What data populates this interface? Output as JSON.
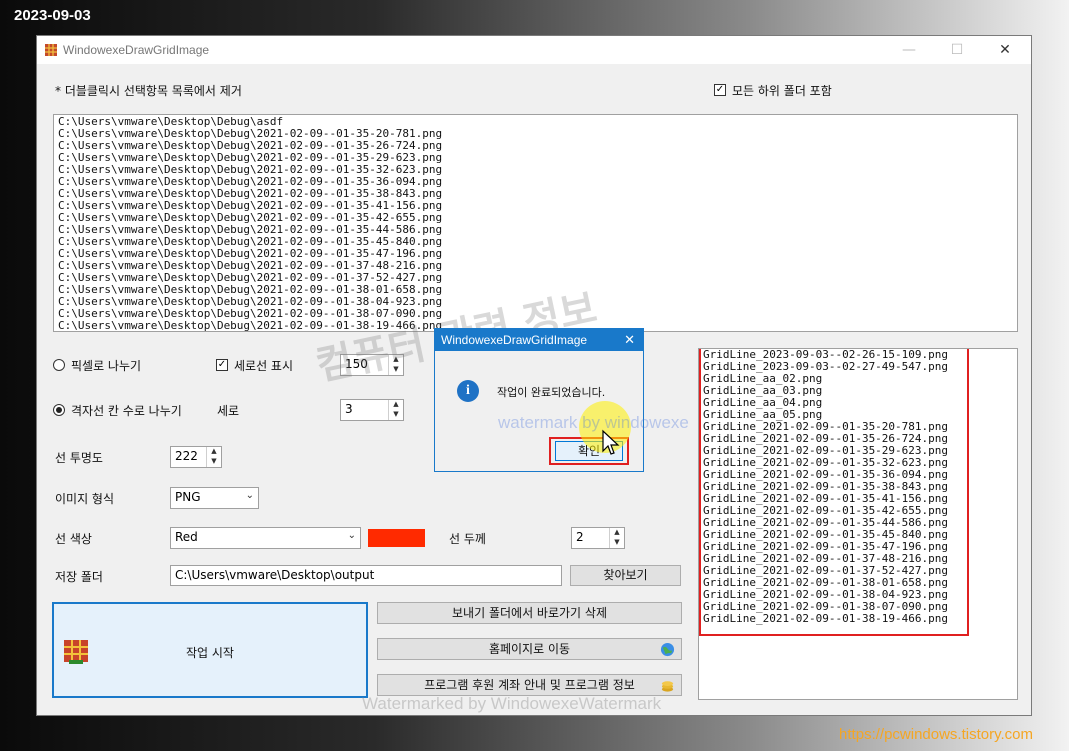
{
  "overlay": {
    "date": "2023-09-03",
    "site_url": "https://pcwindows.tistory.com",
    "watermark_korean": "컴퓨터 관련 정보",
    "watermark_dialog": "watermark by windowexe",
    "watermark_bottom": "Watermarked by WindowexeWatermark"
  },
  "window": {
    "title": "WindowexeDrawGridImage",
    "minimize": "—",
    "maximize": "☐",
    "close": "✕"
  },
  "main": {
    "hint_label": "* 더블클릭시 선택항목 목록에서 제거",
    "include_subfolders_label": "모든 하위 폴더 포함",
    "include_subfolders_checked": true,
    "file_list": [
      "C:\\Users\\vmware\\Desktop\\Debug\\asdf",
      "C:\\Users\\vmware\\Desktop\\Debug\\2021-02-09--01-35-20-781.png",
      "C:\\Users\\vmware\\Desktop\\Debug\\2021-02-09--01-35-26-724.png",
      "C:\\Users\\vmware\\Desktop\\Debug\\2021-02-09--01-35-29-623.png",
      "C:\\Users\\vmware\\Desktop\\Debug\\2021-02-09--01-35-32-623.png",
      "C:\\Users\\vmware\\Desktop\\Debug\\2021-02-09--01-35-36-094.png",
      "C:\\Users\\vmware\\Desktop\\Debug\\2021-02-09--01-35-38-843.png",
      "C:\\Users\\vmware\\Desktop\\Debug\\2021-02-09--01-35-41-156.png",
      "C:\\Users\\vmware\\Desktop\\Debug\\2021-02-09--01-35-42-655.png",
      "C:\\Users\\vmware\\Desktop\\Debug\\2021-02-09--01-35-44-586.png",
      "C:\\Users\\vmware\\Desktop\\Debug\\2021-02-09--01-35-45-840.png",
      "C:\\Users\\vmware\\Desktop\\Debug\\2021-02-09--01-35-47-196.png",
      "C:\\Users\\vmware\\Desktop\\Debug\\2021-02-09--01-37-48-216.png",
      "C:\\Users\\vmware\\Desktop\\Debug\\2021-02-09--01-37-52-427.png",
      "C:\\Users\\vmware\\Desktop\\Debug\\2021-02-09--01-38-01-658.png",
      "C:\\Users\\vmware\\Desktop\\Debug\\2021-02-09--01-38-04-923.png",
      "C:\\Users\\vmware\\Desktop\\Debug\\2021-02-09--01-38-07-090.png",
      "C:\\Users\\vmware\\Desktop\\Debug\\2021-02-09--01-38-19-466.png"
    ],
    "pixel_split_label": "픽셀로 나누기",
    "pixel_split_selected": false,
    "vertical_line_label": "세로선 표시",
    "vertical_line_checked": true,
    "pixel_value": "150",
    "grid_cells_label": "격자선 칸 수로 나누기",
    "grid_cells_selected": true,
    "vertical_label": "세로",
    "vertical_value": "3",
    "opacity_label": "선 투명도",
    "opacity_value": "222",
    "format_label": "이미지 형식",
    "format_value": "PNG",
    "color_label": "선 색상",
    "color_value": "Red",
    "color_swatch": "#ff2a00",
    "thickness_label": "선 두께",
    "thickness_value": "2",
    "save_folder_label": "저장 폴더",
    "save_folder_value": "C:\\Users\\vmware\\Desktop\\output",
    "browse_label": "찾아보기",
    "start_label": "작업 시작",
    "delete_shortcut_label": "보내기 폴더에서 바로가기 삭제",
    "homepage_label": "홈페이지로 이동",
    "donate_label": "프로그램 후원 계좌 안내 및 프로그램 정보"
  },
  "output_list": [
    "GridLine_2023-09-03--02-26-15-109.png",
    "GridLine_2023-09-03--02-27-49-547.png",
    "GridLine_aa_02.png",
    "GridLine_aa_03.png",
    "GridLine_aa_04.png",
    "GridLine_aa_05.png",
    "GridLine_2021-02-09--01-35-20-781.png",
    "GridLine_2021-02-09--01-35-26-724.png",
    "GridLine_2021-02-09--01-35-29-623.png",
    "GridLine_2021-02-09--01-35-32-623.png",
    "GridLine_2021-02-09--01-35-36-094.png",
    "GridLine_2021-02-09--01-35-38-843.png",
    "GridLine_2021-02-09--01-35-41-156.png",
    "GridLine_2021-02-09--01-35-42-655.png",
    "GridLine_2021-02-09--01-35-44-586.png",
    "GridLine_2021-02-09--01-35-45-840.png",
    "GridLine_2021-02-09--01-35-47-196.png",
    "GridLine_2021-02-09--01-37-48-216.png",
    "GridLine_2021-02-09--01-37-52-427.png",
    "GridLine_2021-02-09--01-38-01-658.png",
    "GridLine_2021-02-09--01-38-04-923.png",
    "GridLine_2021-02-09--01-38-07-090.png",
    "GridLine_2021-02-09--01-38-19-466.png"
  ],
  "dialog": {
    "title": "WindowexeDrawGridImage",
    "close": "✕",
    "icon": "i",
    "message": "작업이 완료되었습니다.",
    "ok_label": "확인"
  },
  "colors": {
    "highlight_red": "#e02020",
    "dialog_blue": "#1979ca",
    "accent_orange": "#f5a623"
  }
}
